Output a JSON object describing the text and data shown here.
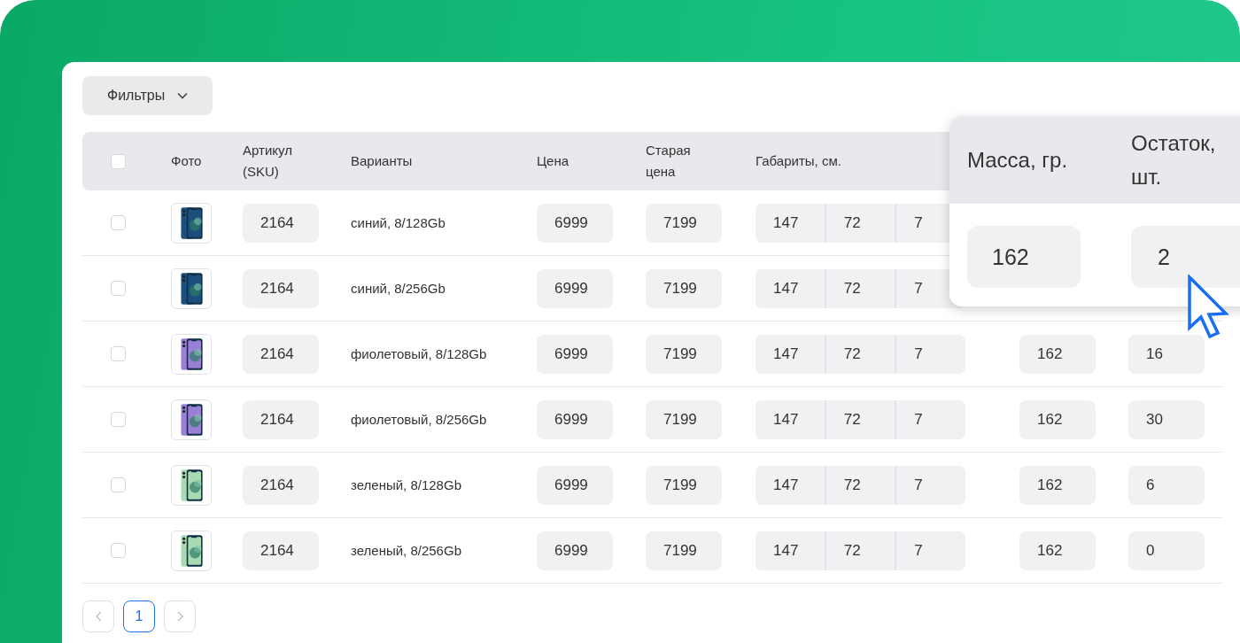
{
  "filters_button": {
    "label": "Фильтры"
  },
  "table": {
    "header_checkbox": {
      "checked": false
    },
    "columns": [
      "Фото",
      "Артикул (SKU)",
      "Варианты",
      "Цена",
      "Старая цена",
      "Габариты, см."
    ],
    "rows": [
      {
        "checked": false,
        "color": "#1d4f7c",
        "sku": "2164",
        "variant": "синий, 8/128Gb",
        "price": "6999",
        "old_price": "7199",
        "dims": [
          "147",
          "72",
          "7"
        ]
      },
      {
        "checked": false,
        "color": "#1d4f7c",
        "sku": "2164",
        "variant": "синий, 8/256Gb",
        "price": "6999",
        "old_price": "7199",
        "dims": [
          "147",
          "72",
          "7"
        ]
      },
      {
        "checked": false,
        "color": "#9a7fd6",
        "sku": "2164",
        "variant": "фиолетовый, 8/128Gb",
        "price": "6999",
        "old_price": "7199",
        "dims": [
          "147",
          "72",
          "7"
        ],
        "mass": "162",
        "stock": "16"
      },
      {
        "checked": false,
        "color": "#9a7fd6",
        "sku": "2164",
        "variant": "фиолетовый, 8/256Gb",
        "price": "6999",
        "old_price": "7199",
        "dims": [
          "147",
          "72",
          "7"
        ],
        "mass": "162",
        "stock": "30"
      },
      {
        "checked": false,
        "color": "#a8dbb4",
        "sku": "2164",
        "variant": "зеленый, 8/128Gb",
        "price": "6999",
        "old_price": "7199",
        "dims": [
          "147",
          "72",
          "7"
        ],
        "mass": "162",
        "stock": "6"
      },
      {
        "checked": false,
        "color": "#a8dbb4",
        "sku": "2164",
        "variant": "зеленый, 8/256Gb",
        "price": "6999",
        "old_price": "7199",
        "dims": [
          "147",
          "72",
          "7"
        ],
        "mass": "162",
        "stock": "0"
      }
    ]
  },
  "zoom_popup": {
    "columns": [
      "Масса, гр.",
      "Остаток, шт."
    ],
    "values": [
      "162",
      "2"
    ]
  },
  "pagination": {
    "pages": [
      {
        "label": "1",
        "selected": true
      }
    ]
  }
}
